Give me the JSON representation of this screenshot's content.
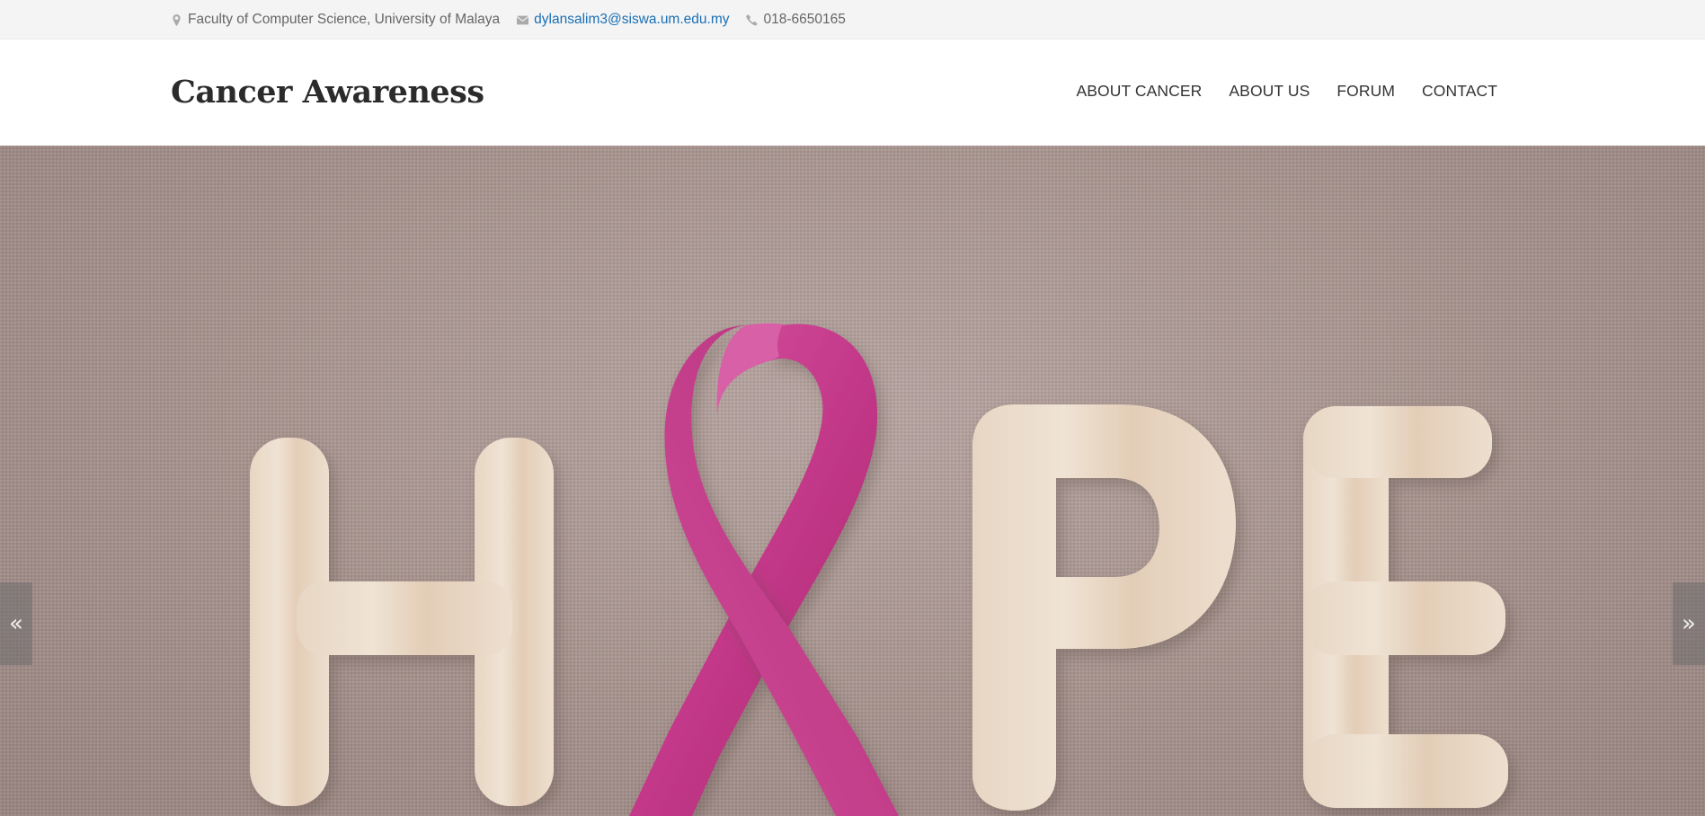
{
  "topbar": {
    "address": "Faculty of Computer Science, University of Malaya",
    "email": "dylansalim3@siswa.um.edu.my",
    "phone": "018-6650165",
    "icons": {
      "address": "map-marker-icon",
      "email": "envelope-icon",
      "phone": "phone-icon"
    }
  },
  "header": {
    "logo": "Cancer Awareness",
    "nav": [
      {
        "label": "ABOUT CANCER"
      },
      {
        "label": "ABOUT US"
      },
      {
        "label": "FORUM"
      },
      {
        "label": "CONTACT"
      }
    ]
  },
  "slider": {
    "prev_label": "«",
    "next_label": "»",
    "image_word": "HOPE"
  },
  "colors": {
    "topbar_bg": "#f4f4f4",
    "link": "#1a6fb5",
    "ribbon": "#c8418c",
    "wood_letter": "#eadccb",
    "burlap": "#a8948f"
  }
}
